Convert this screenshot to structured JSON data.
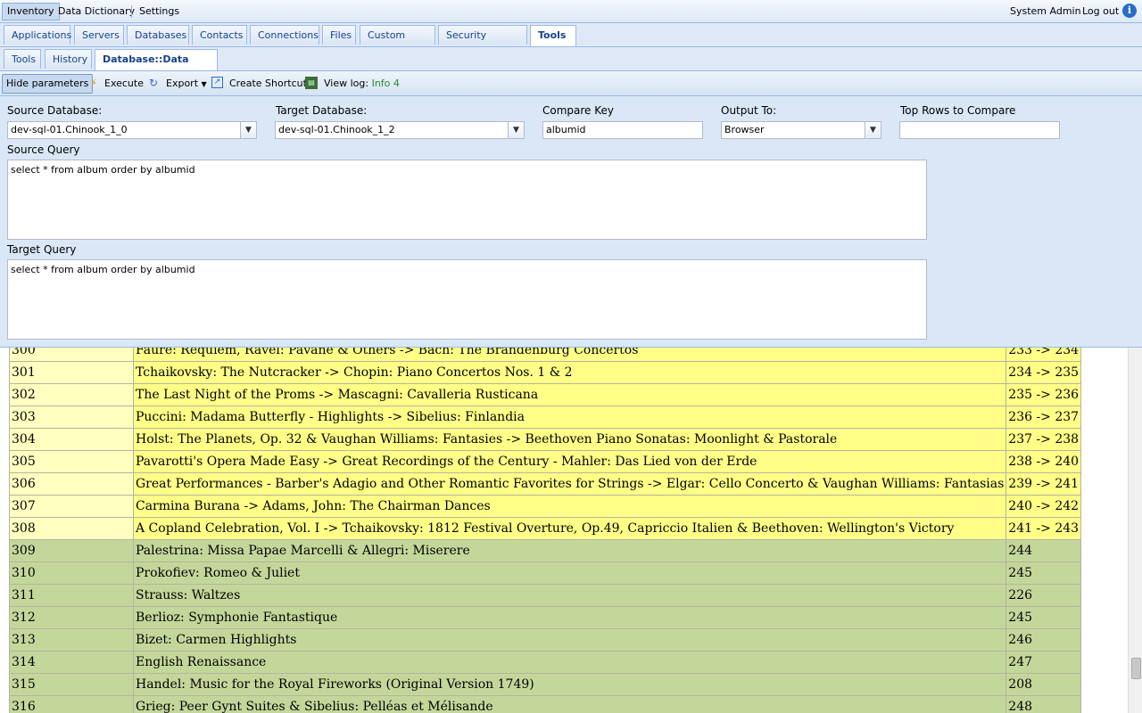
{
  "topmenu": {
    "items": [
      "Inventory",
      "Data Dictionary",
      "Settings"
    ],
    "user": "System Admin",
    "logout": "Log out"
  },
  "main_tabs": [
    "Applications",
    "Servers",
    "Databases",
    "Contacts",
    "Connections",
    "Files",
    "Custom Fields",
    "Security Settings",
    "Tools"
  ],
  "sub_tabs": [
    "Tools",
    "History",
    "Database::Data diff"
  ],
  "toolbar": {
    "hide_params": "Hide parameters",
    "execute": "Execute",
    "export": "Export",
    "create_shortcut": "Create Shortcut",
    "view_log": "View log:",
    "view_log_info": "Info 4"
  },
  "params": {
    "source_db_label": "Source Database:",
    "source_db_value": "dev-sql-01.Chinook_1_0",
    "target_db_label": "Target Database:",
    "target_db_value": "dev-sql-01.Chinook_1_2",
    "compare_key_label": "Compare Key",
    "compare_key_value": "albumid",
    "output_label": "Output To:",
    "output_value": "Browser",
    "top_rows_label": "Top Rows to Compare",
    "top_rows_value": "",
    "source_query_label": "Source Query",
    "source_query": "select * from album order by albumid",
    "target_query_label": "Target Query",
    "target_query": "select * from album order by albumid"
  },
  "rows": [
    {
      "id": "300",
      "name": "Fauré: Requiem, Ravel: Pavane & Others -> Bach: The Brandenburg Concertos",
      "val": "233 -> 234",
      "changed": true
    },
    {
      "id": "301",
      "name": "Tchaikovsky: The Nutcracker -> Chopin: Piano Concertos Nos. 1 & 2",
      "val": "234 -> 235",
      "changed": true
    },
    {
      "id": "302",
      "name": "The Last Night of the Proms -> Mascagni: Cavalleria Rusticana",
      "val": "235 -> 236",
      "changed": true
    },
    {
      "id": "303",
      "name": "Puccini: Madama Butterfly - Highlights -> Sibelius: Finlandia",
      "val": "236 -> 237",
      "changed": true
    },
    {
      "id": "304",
      "name": "Holst: The Planets, Op. 32 & Vaughan Williams: Fantasies -> Beethoven Piano Sonatas: Moonlight & Pastorale",
      "val": "237 -> 238",
      "changed": true
    },
    {
      "id": "305",
      "name": "Pavarotti's Opera Made Easy -> Great Recordings of the Century - Mahler: Das Lied von der Erde",
      "val": "238 -> 240",
      "changed": true
    },
    {
      "id": "306",
      "name": "Great Performances - Barber's Adagio and Other Romantic Favorites for Strings -> Elgar: Cello Concerto & Vaughan Williams: Fantasias",
      "val": "239 -> 241",
      "changed": true
    },
    {
      "id": "307",
      "name": "Carmina Burana -> Adams, John: The Chairman Dances",
      "val": "240 -> 242",
      "changed": true
    },
    {
      "id": "308",
      "name": "A Copland Celebration, Vol. I -> Tchaikovsky: 1812 Festival Overture, Op.49, Capriccio Italien & Beethoven: Wellington's Victory",
      "val": "241 -> 243",
      "changed": true
    },
    {
      "id": "309",
      "name": "Palestrina: Missa Papae Marcelli & Allegri: Miserere",
      "val": "244",
      "changed": false
    },
    {
      "id": "310",
      "name": "Prokofiev: Romeo & Juliet",
      "val": "245",
      "changed": false
    },
    {
      "id": "311",
      "name": "Strauss: Waltzes",
      "val": "226",
      "changed": false
    },
    {
      "id": "312",
      "name": "Berlioz: Symphonie Fantastique",
      "val": "245",
      "changed": false
    },
    {
      "id": "313",
      "name": "Bizet: Carmen Highlights",
      "val": "246",
      "changed": false
    },
    {
      "id": "314",
      "name": "English Renaissance",
      "val": "247",
      "changed": false
    },
    {
      "id": "315",
      "name": "Handel: Music for the Royal Fireworks (Original Version 1749)",
      "val": "208",
      "changed": false
    },
    {
      "id": "316",
      "name": "Grieg: Peer Gynt Suites & Sibelius: Pelléas et Mélisande",
      "val": "248",
      "changed": false
    }
  ]
}
